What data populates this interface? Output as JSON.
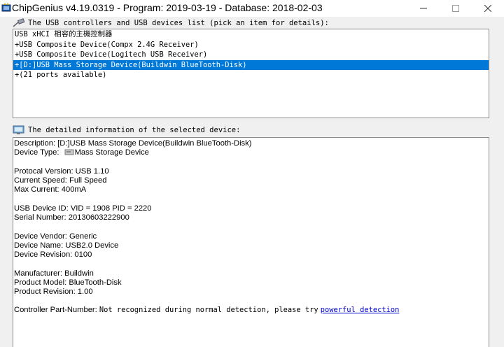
{
  "window": {
    "title": "ChipGenius v4.19.0319 - Program: 2019-03-19 - Database: 2018-02-03",
    "minimize_glyph": "—",
    "maximize_glyph": "☐",
    "close_glyph": "✕"
  },
  "usb_list": {
    "header": "The USB controllers and USB devices list (pick an item for details):",
    "icon": "usb-cable-icon",
    "items": [
      "USB xHCI 相容的主機控制器",
      "+USB Composite Device(Compx 2.4G Receiver)",
      "+USB Composite Device(Logitech USB Receiver)",
      "+[D:]USB Mass Storage Device(Buildwin BlueTooth-Disk)",
      "+(21 ports available)"
    ],
    "selected_index": 3
  },
  "details": {
    "header": "The detailed information of the selected device:",
    "icon": "monitor-info-icon",
    "description": "Description: [D:]USB Mass Storage Device(Buildwin BlueTooth-Disk)",
    "device_type_label": "Device Type:",
    "device_type_value": "Mass Storage Device",
    "device_type_icon": "drive-icon",
    "protocol_version": "Protocal Version: USB 1.10",
    "current_speed": "Current Speed: Full Speed",
    "max_current": "Max Current: 400mA",
    "usb_device_id": "USB Device ID: VID = 1908 PID = 2220",
    "serial_number": "Serial Number: 20130603222900",
    "device_vendor": "Device Vendor: Generic",
    "device_name": "Device Name: USB2.0 Device",
    "device_revision": "Device Revision: 0100",
    "manufacturer": "Manufacturer: Buildwin",
    "product_model": "Product Model: BlueTooth-Disk",
    "product_revision": "Product Revision: 1.00",
    "controller_label": "Controller Part-Number:",
    "controller_note": "Not recognized during normal detection, please try",
    "controller_link": "powerful detection"
  },
  "colors": {
    "selection": "#0078d7",
    "link": "#0000cc"
  }
}
